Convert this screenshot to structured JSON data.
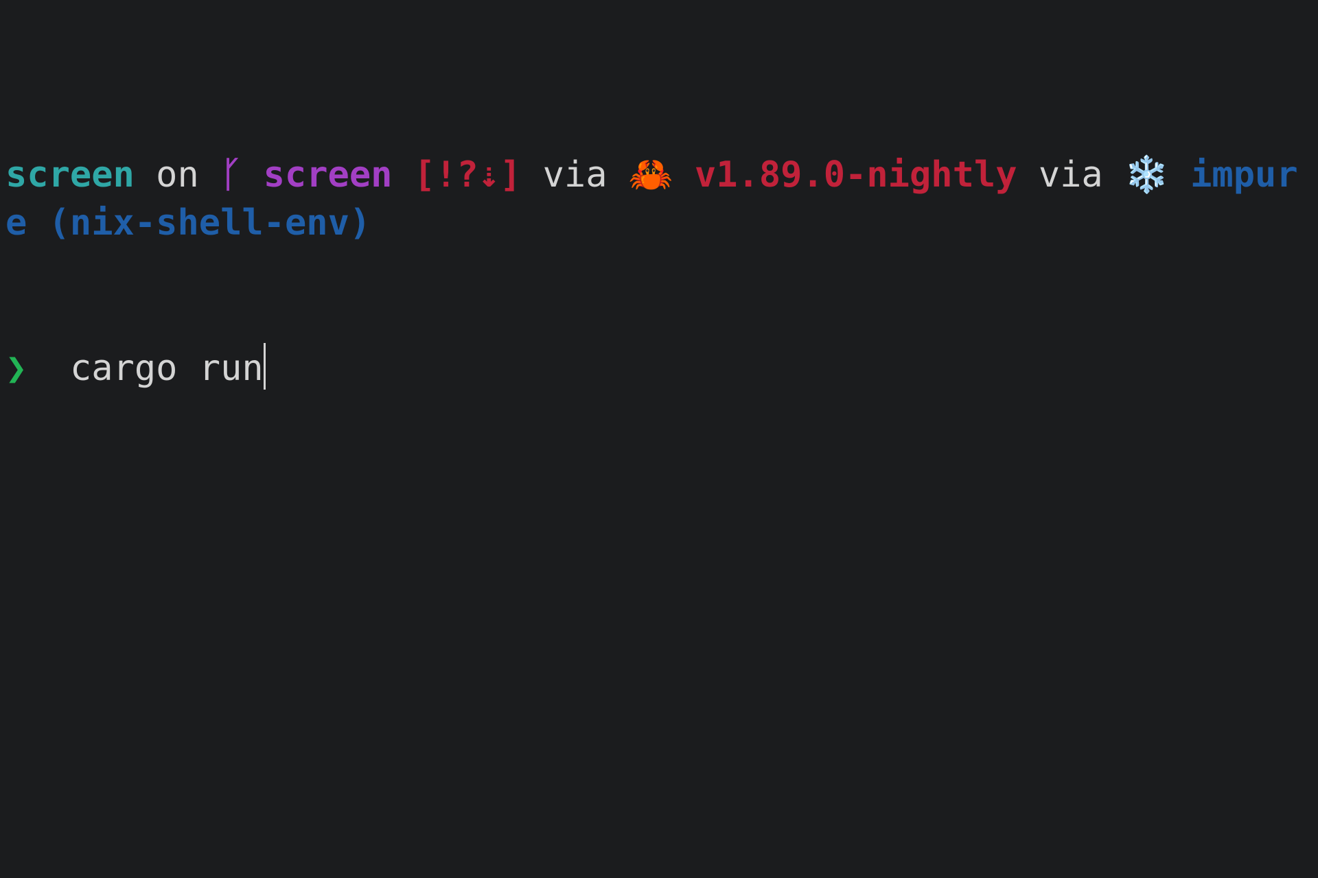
{
  "prompt": {
    "directory": "screen",
    "on_word": " on ",
    "branch_icon": "ᚴ",
    "branch_icon_name": "git-branch-icon",
    "branch": "screen",
    "git_status": "[!?⇣]",
    "via_word_1": " via ",
    "rust_icon": "🦀",
    "rust_icon_name": "crab-icon",
    "rust_version": "v1.89.0-nightly",
    "via_word_2": " via ",
    "nix_icon": "❄️",
    "nix_icon_name": "snowflake-icon",
    "nix_env": "impure (nix-shell-env)",
    "prompt_symbol": "❯"
  },
  "input": {
    "command": "cargo run"
  },
  "colors": {
    "background": "#1b1c1e",
    "directory": "#2fa7a6",
    "branch": "#a23fc4",
    "status": "#c1223a",
    "rust": "#c1223a",
    "nix": "#1f5ea8",
    "prompt_symbol": "#22b455",
    "text": "#d4d4d4"
  }
}
